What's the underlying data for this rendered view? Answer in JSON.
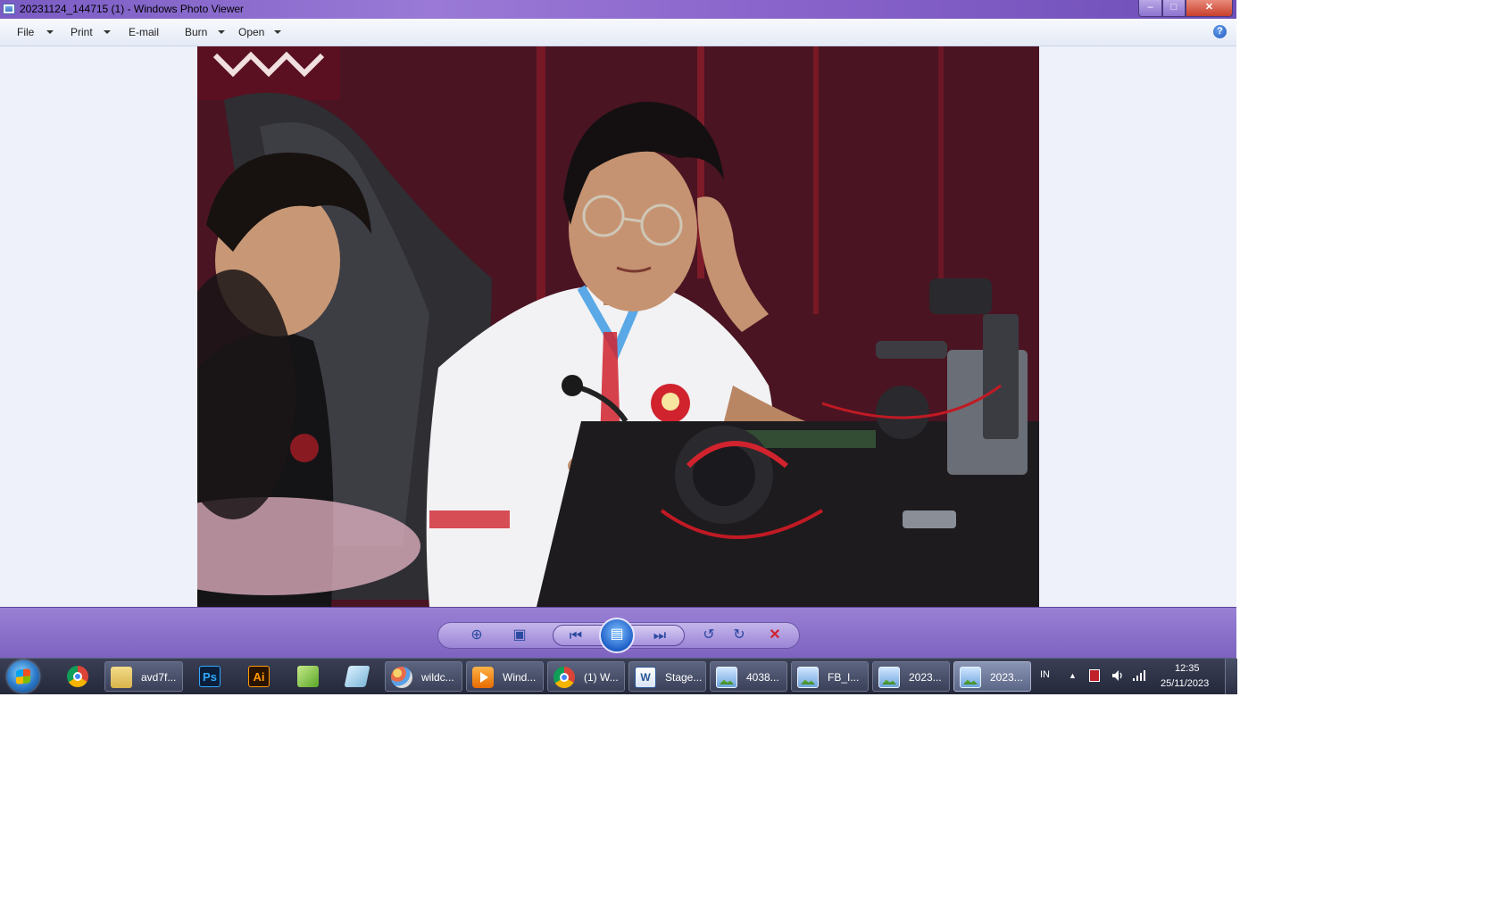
{
  "window": {
    "title": "20231124_144715 (1) - Windows Photo Viewer",
    "controls": {
      "minimize": "–",
      "maximize": "□",
      "close": "✕"
    }
  },
  "menubar": {
    "items": [
      {
        "label": "File",
        "has_dropdown": true
      },
      {
        "label": "Print",
        "has_dropdown": true
      },
      {
        "label": "E-mail",
        "has_dropdown": false
      },
      {
        "label": "Burn",
        "has_dropdown": true
      },
      {
        "label": "Open",
        "has_dropdown": true
      }
    ],
    "help_glyph": "?"
  },
  "photo": {
    "description_icon": "photo-of-gamer-in-jersey",
    "colors": {
      "background": "#5a1828",
      "jersey": "#f2f2f4",
      "accent": "#d0232e"
    }
  },
  "controls": {
    "zoom_glyph": "⊕",
    "fit_glyph": "▣",
    "previous_glyph": "⏮",
    "slideshow_glyph": "▤",
    "next_glyph": "⏭",
    "rotate_ccw_glyph": "↺",
    "rotate_cw_glyph": "↻",
    "delete_glyph": "✕"
  },
  "taskbar": {
    "pinned": [
      {
        "name": "chrome",
        "icon": "chrome-icon"
      },
      {
        "name": "photoshop",
        "icon": "photoshop-icon",
        "text": "Ps"
      },
      {
        "name": "illustrator",
        "icon": "illustrator-icon",
        "text": "Ai"
      },
      {
        "name": "green-app",
        "icon": "green-app-icon"
      },
      {
        "name": "book-app",
        "icon": "book-app-icon"
      }
    ],
    "tasks": [
      {
        "label": "avd7f...",
        "icon": "folder-icon"
      },
      {
        "label": "wildc...",
        "icon": "paint-icon"
      },
      {
        "label": "Wind...",
        "icon": "media-player-icon"
      },
      {
        "label": "(1) W...",
        "icon": "chrome-icon"
      },
      {
        "label": "Stage...",
        "icon": "word-icon",
        "text": "W"
      },
      {
        "label": "4038...",
        "icon": "photo-viewer-icon"
      },
      {
        "label": "FB_I...",
        "icon": "photo-viewer-icon"
      },
      {
        "label": "2023...",
        "icon": "photo-viewer-icon"
      },
      {
        "label": "2023...",
        "icon": "photo-viewer-icon",
        "active": true
      }
    ],
    "tray": {
      "language": "IN",
      "show_hidden_glyph": "▲",
      "time": "12:35",
      "date": "25/11/2023"
    }
  }
}
